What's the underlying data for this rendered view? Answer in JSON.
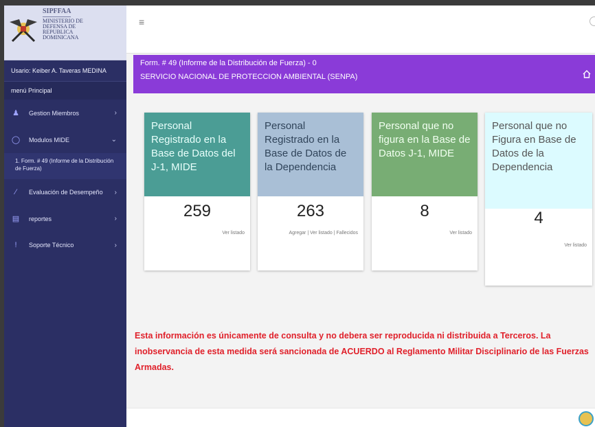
{
  "brand": {
    "abbr": "SIPFFAA",
    "org_lines": [
      "MINISTERIO DE",
      "DEFENSA DE",
      "REPUBLICA",
      "DOMINICANA"
    ]
  },
  "sidebar": {
    "user": "Usario: Keiber A. Taveras MEDINA",
    "menu_header": "menú Principal",
    "items": [
      {
        "label": "Gestion Miembros",
        "icon": "user-icon",
        "chevron": "›"
      },
      {
        "label": "Modulos MIDE",
        "icon": "settings-icon",
        "chevron": "⌄"
      },
      {
        "label": "Evaluación de Desempeño",
        "icon": "edit-icon",
        "chevron": "›"
      },
      {
        "label": "reportes",
        "icon": "document-icon",
        "chevron": "›"
      },
      {
        "label": "Soporte Técnico",
        "icon": "info-icon",
        "chevron": "›"
      }
    ],
    "submenu_item": "1. Form. # 49 (Informe de la Distribución de Fuerza)"
  },
  "topbar": {
    "menu_glyph": "≡"
  },
  "form_header": {
    "title": "Form. # 49 (Informe de la Distribución de Fuerza) - 0",
    "subtitle": "SERVICIO NACIONAL DE PROTECCION AMBIENTAL (SENPA)"
  },
  "cards": [
    {
      "title": "Personal Registrado en la Base de Datos del J-1, MIDE",
      "value": "259",
      "links": "Ver listado"
    },
    {
      "title": "Personal Registrado en la Base de Datos de la Dependencia",
      "value": "263",
      "links": "Agregar | Ver listado | Fallecidos"
    },
    {
      "title": "Personal que no figura en la Base de Datos J-1, MIDE",
      "value": "8",
      "links": "Ver listado"
    },
    {
      "title": "Personal que no Figura en Base de Datos de la Dependencia",
      "value": "4",
      "links": "Ver listado"
    }
  ],
  "notice": "Esta información es únicamente de consulta y no debera ser reproducida ni distribuida a Terceros. La inobservancia de esta medida será sancionada de ACUERDO al Reglamento Militar Disciplinario de las Fuerzas Armadas."
}
